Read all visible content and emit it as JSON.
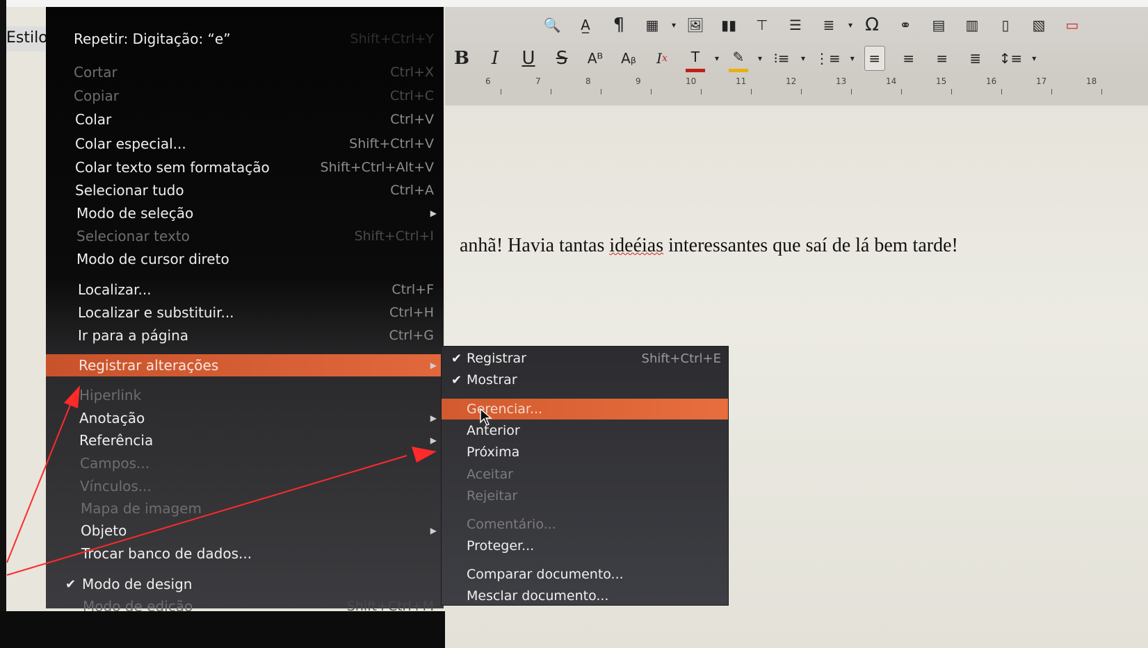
{
  "toolbar": {
    "estilo_label": "Estilo",
    "bold": "B",
    "italic": "I",
    "underline": "U",
    "strike": "S",
    "omega": "Ω",
    "ruler_numbers": [
      "6",
      "7",
      "8",
      "9",
      "10",
      "11",
      "12",
      "13",
      "14",
      "15",
      "16",
      "17",
      "18"
    ]
  },
  "document": {
    "text_before": "anhã! Havia tantas ",
    "text_misspelled": "ideéias",
    "text_after": " interessantes que saí de lá bem tarde!"
  },
  "edit_menu": {
    "repeat": {
      "label": "Repetir: Digitação: “e”",
      "shortcut": "Shift+Ctrl+Y"
    },
    "items": [
      {
        "label": "Cortar",
        "shortcut": "Ctrl+X",
        "disabled": true
      },
      {
        "label": "Copiar",
        "shortcut": "Ctrl+C",
        "disabled": true
      },
      {
        "label": "Colar",
        "shortcut": "Ctrl+V"
      },
      {
        "label": "Colar especial...",
        "shortcut": "Shift+Ctrl+V"
      },
      {
        "label": "Colar texto sem formatação",
        "shortcut": "Shift+Ctrl+Alt+V"
      },
      {
        "label": "Selecionar tudo",
        "shortcut": "Ctrl+A"
      },
      {
        "label": "Modo de seleção",
        "submenu": true
      },
      {
        "label": "Selecionar texto",
        "shortcut": "Shift+Ctrl+I",
        "disabled": true
      },
      {
        "label": "Modo de cursor direto"
      },
      {
        "label": "Localizar...",
        "shortcut": "Ctrl+F"
      },
      {
        "label": "Localizar e substituir...",
        "shortcut": "Ctrl+H"
      },
      {
        "label": "Ir para a página",
        "shortcut": "Ctrl+G"
      },
      {
        "label": "Registrar alterações",
        "submenu": true,
        "highlighted": true
      },
      {
        "label": "Hiperlink",
        "disabled": true
      },
      {
        "label": "Anotação",
        "submenu": true
      },
      {
        "label": "Referência",
        "submenu": true
      },
      {
        "label": "Campos...",
        "disabled": true
      },
      {
        "label": "Vínculos...",
        "disabled": true
      },
      {
        "label": "Mapa de imagem",
        "disabled": true
      },
      {
        "label": "Objeto",
        "submenu": true
      },
      {
        "label": "Trocar banco de dados..."
      },
      {
        "label": "Modo de design",
        "checked": true
      },
      {
        "label": "Modo de edição",
        "shortcut": "Shift+Ctrl+M",
        "disabled": true
      }
    ]
  },
  "track_changes_submenu": {
    "items": [
      {
        "label": "Registrar",
        "shortcut": "Shift+Ctrl+E",
        "checked": true
      },
      {
        "label": "Mostrar",
        "checked": true
      },
      {
        "label": "Gerenciar...",
        "highlighted": true
      },
      {
        "label": "Anterior"
      },
      {
        "label": "Próxima"
      },
      {
        "label": "Aceitar",
        "disabled": true
      },
      {
        "label": "Rejeitar",
        "disabled": true
      },
      {
        "label": "Comentário...",
        "disabled": true
      },
      {
        "label": "Proteger..."
      },
      {
        "label": "Comparar documento..."
      },
      {
        "label": "Mesclar documento..."
      }
    ]
  },
  "colors": {
    "highlight": "#e2683c",
    "annotation_arrow": "#ff2a2a",
    "menu_bg": "#0b0b0b",
    "font_color_swatch": "#c0201a",
    "highlight_swatch": "#e8b010"
  }
}
